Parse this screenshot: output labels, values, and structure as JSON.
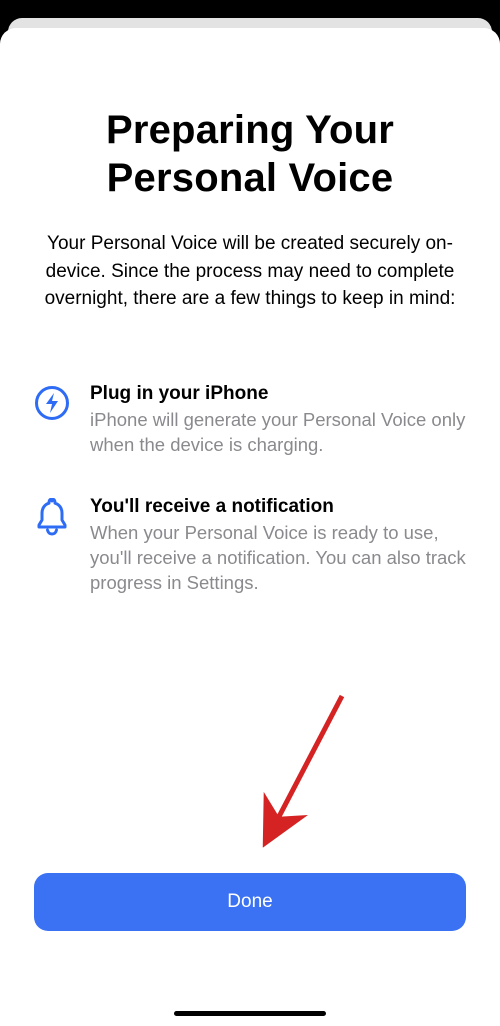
{
  "header": {
    "title": "Preparing Your Personal Voice",
    "subtitle": "Your Personal Voice will be created securely on-device. Since the process may need to complete overnight, there are a few things to keep in mind:"
  },
  "items": [
    {
      "icon": "bolt-icon",
      "title": "Plug in your iPhone",
      "desc": "iPhone will generate your Personal Voice only when the device is charging."
    },
    {
      "icon": "bell-icon",
      "title": "You'll receive a notification",
      "desc": "When your Personal Voice is ready to use, you'll receive a notification. You can also track progress in Settings."
    }
  ],
  "button": {
    "done_label": "Done"
  },
  "colors": {
    "accent": "#3a72f3",
    "icon_blue": "#2e6cf6",
    "annotation_red": "#d52323"
  }
}
